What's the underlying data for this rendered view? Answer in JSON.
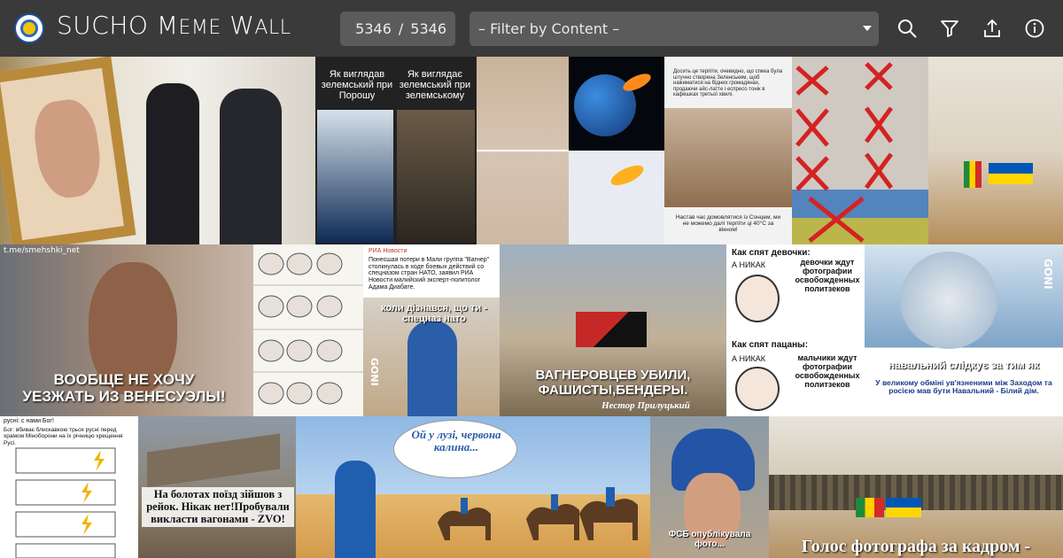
{
  "header": {
    "title_parts": [
      "SUCHO",
      "M",
      "EME",
      "W",
      "ALL"
    ],
    "counter_current": "5346",
    "counter_sep": "/",
    "counter_total": "5346",
    "filter_placeholder": "– Filter by Content –",
    "icons": [
      "search-icon",
      "filter-icon",
      "upload-icon",
      "info-icon"
    ]
  },
  "memes": {
    "zelensky_left_caption": "Як виглядав зелемський при Порошу",
    "zelensky_right_caption": "Як виглядає зелемський при зелемському",
    "heat_top": "Досить це терпіти, очевидно, що спека була штучно створена Зеленським, щоб нажиматися на бідних громадянах, продаючи айс-латте і еспресо тонік в кафешках третьої хвилі.",
    "heat_bottom": "Настав час домовлятися із Сонцем, ми не можемо далі терпіти ці 40°С за вікном!",
    "maduro_caption": "ВООБЩЕ НЕ ХОЧУ УЕЗЖАТЬ ИЗ ВЕНЕСУЭЛЫ!",
    "maduro_watermark": "t.me/smehshki_net",
    "ria_source": "РИА Новости",
    "ria_text": "Понесшая потери в Мали группа \"Вагнер\" столкнулась в ходе боевых действий со спецназом стран НАТО, заявил РИА Новости малийский эксперт-политолог Адама Диабате.",
    "spetsnaz_caption": "коли дізнався, що ти - спецназ нато",
    "wagner_caption": "ВАГНЕРОВЦЕВ УБИЛИ, ФАШИСТЫ,БЕНДЕРЫ.",
    "wagner_author": "Нестор Прилуцький",
    "girls_title": "Как спят девочки:",
    "girls_a": "А НИКАК",
    "girls_text": "девочки ждут фотографии освобожденных политзеков",
    "boys_title": "Как спят пацаны:",
    "boys_a": "А НИКАК",
    "boys_text": "мальчики ждут фотографии освобожденных политзеков",
    "navalny_caption": "навальний слідкує за тим як",
    "navalny_sub": "У великому обміні ув'язненими між Заходом та росією мав бути Навальний - Білий дім.",
    "gonzo": "GONI",
    "russian_god_1": "русні: с нами Бог!",
    "russian_god_2": "Бог: вбиває блискавкою трьох русні перед храмом Міноборони на їх річницю хрещення Русі.",
    "train_caption": "На болотах поїзд зійшов з рейок. Нікак нет!Пробували викласти вагонами - ZVO!",
    "camel_bubble": "Ой у лузі, червона калина...",
    "fsb_caption": "ФСБ опублікувала фото...",
    "last_caption": "Голос фотографа за кадром -"
  },
  "colors": {
    "header_bg": "#3a3a3a",
    "input_bg": "#5b5b5b",
    "ua_blue": "#0057b7",
    "ua_yellow": "#ffd700"
  }
}
